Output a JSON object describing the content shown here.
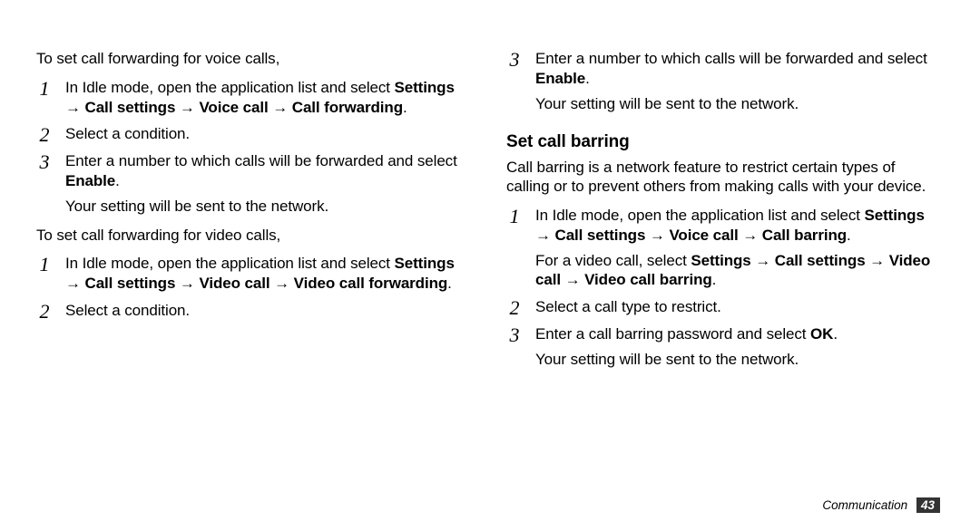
{
  "left": {
    "para1": "To set call forwarding for voice calls,",
    "list1": [
      {
        "num": "1",
        "lines": [
          {
            "text": "In Idle mode, open the application list and select "
          },
          {
            "text": "Settings → Call settings → Voice call → Call forwarding",
            "bold": true
          },
          {
            "text": "."
          }
        ]
      },
      {
        "num": "2",
        "lines": [
          {
            "text": "Select a condition."
          }
        ]
      },
      {
        "num": "3",
        "paragraphs": [
          [
            {
              "text": "Enter a number to which calls will be forwarded and select "
            },
            {
              "text": "Enable",
              "bold": true
            },
            {
              "text": "."
            }
          ],
          [
            {
              "text": "Your setting will be sent to the network."
            }
          ]
        ]
      }
    ],
    "para2": "To set call forwarding for video calls,",
    "list2": [
      {
        "num": "1",
        "lines": [
          {
            "text": "In Idle mode, open the application list and select "
          },
          {
            "text": "Settings → Call settings → Video call → Video call forwarding",
            "bold": true
          },
          {
            "text": "."
          }
        ]
      },
      {
        "num": "2",
        "lines": [
          {
            "text": "Select a condition."
          }
        ]
      }
    ]
  },
  "right": {
    "list1": [
      {
        "num": "3",
        "paragraphs": [
          [
            {
              "text": "Enter a number to which calls will be forwarded and select "
            },
            {
              "text": "Enable",
              "bold": true
            },
            {
              "text": "."
            }
          ],
          [
            {
              "text": "Your setting will be sent to the network."
            }
          ]
        ]
      }
    ],
    "heading": "Set call barring",
    "para1": "Call barring is a network feature to restrict certain types of calling or to prevent others from making calls with your device.",
    "list2": [
      {
        "num": "1",
        "paragraphs": [
          [
            {
              "text": "In Idle mode, open the application list and select "
            },
            {
              "text": "Settings → Call settings → Voice call → Call barring",
              "bold": true
            },
            {
              "text": "."
            }
          ],
          [
            {
              "text": "For a video call, select "
            },
            {
              "text": "Settings → Call settings → Video call → Video call barring",
              "bold": true
            },
            {
              "text": "."
            }
          ]
        ]
      },
      {
        "num": "2",
        "lines": [
          {
            "text": "Select a call type to restrict."
          }
        ]
      },
      {
        "num": "3",
        "paragraphs": [
          [
            {
              "text": "Enter a call barring password and select "
            },
            {
              "text": "OK",
              "bold": true
            },
            {
              "text": "."
            }
          ],
          [
            {
              "text": "Your setting will be sent to the network."
            }
          ]
        ]
      }
    ]
  },
  "footer": {
    "section": "Communication",
    "page": "43"
  }
}
